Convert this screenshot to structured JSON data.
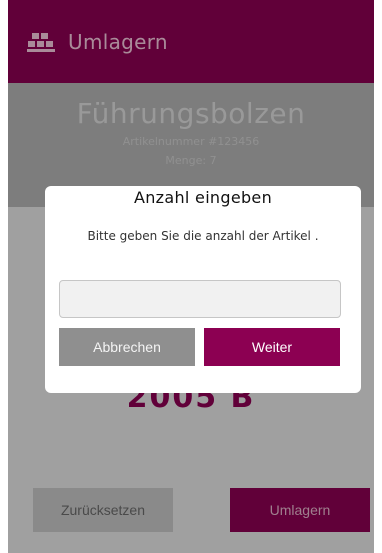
{
  "app": {
    "title": "Umlagern",
    "logo_icon": "warehouse-boxes-icon"
  },
  "article": {
    "name": "Führungsbolzen",
    "number_line": "Artikelnummer #123456",
    "quantity_line": "Menge: 7"
  },
  "target_bin": "2005 B",
  "actions": {
    "reset_label": "Zurücksetzen",
    "move_label": "Umlagern"
  },
  "dialog": {
    "title": "Anzahl eingeben",
    "message": "Bitte geben Sie die anzahl der Artikel  .",
    "input_value": "",
    "cancel_label": "Abbrechen",
    "next_label": "Weiter"
  },
  "colors": {
    "brand": "#8c0052",
    "overlay": "rgba(0,0,0,0.30)",
    "dialog_bg": "#ffffff"
  }
}
